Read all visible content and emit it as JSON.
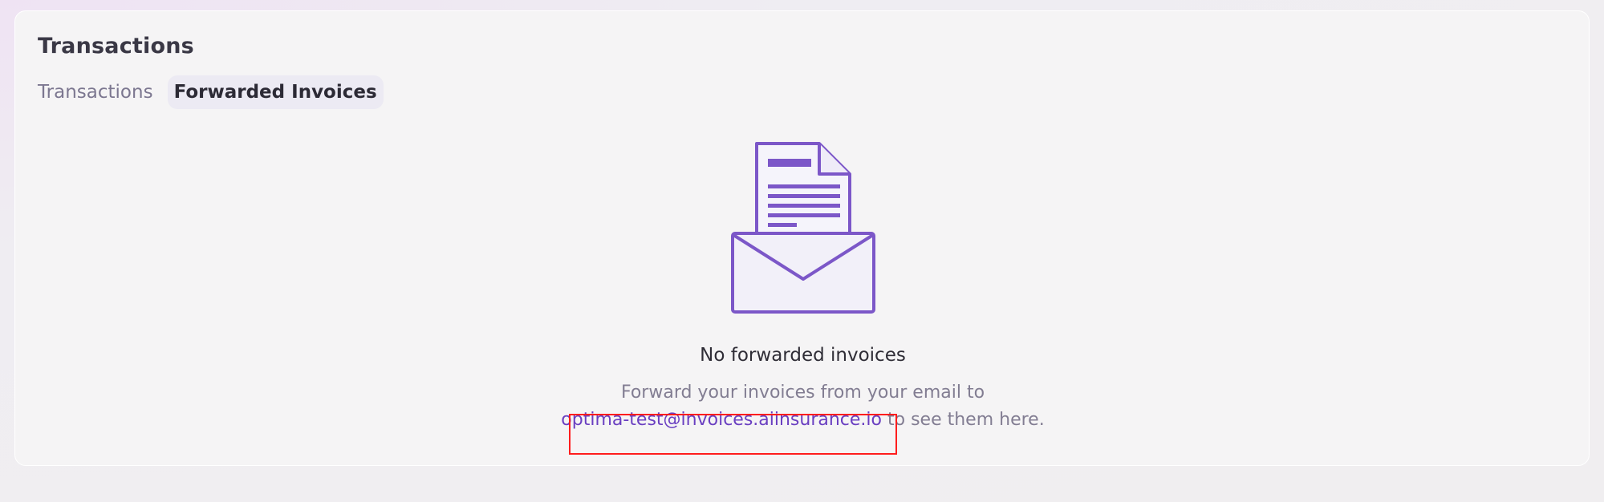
{
  "page": {
    "title": "Transactions"
  },
  "tabs": [
    {
      "label": "Transactions",
      "active": false
    },
    {
      "label": "Forwarded Invoices",
      "active": true
    }
  ],
  "empty_state": {
    "illustration_icon": "envelope-invoice-icon",
    "title": "No forwarded invoices",
    "body_prefix": "Forward your invoices from your email to",
    "email": "optima-test@invoices.aiinsurance.io",
    "body_suffix": "to see them here."
  },
  "colors": {
    "accent": "#6a3fc1",
    "illustration": "#7c57c8",
    "highlight": "#ff1d1d"
  }
}
